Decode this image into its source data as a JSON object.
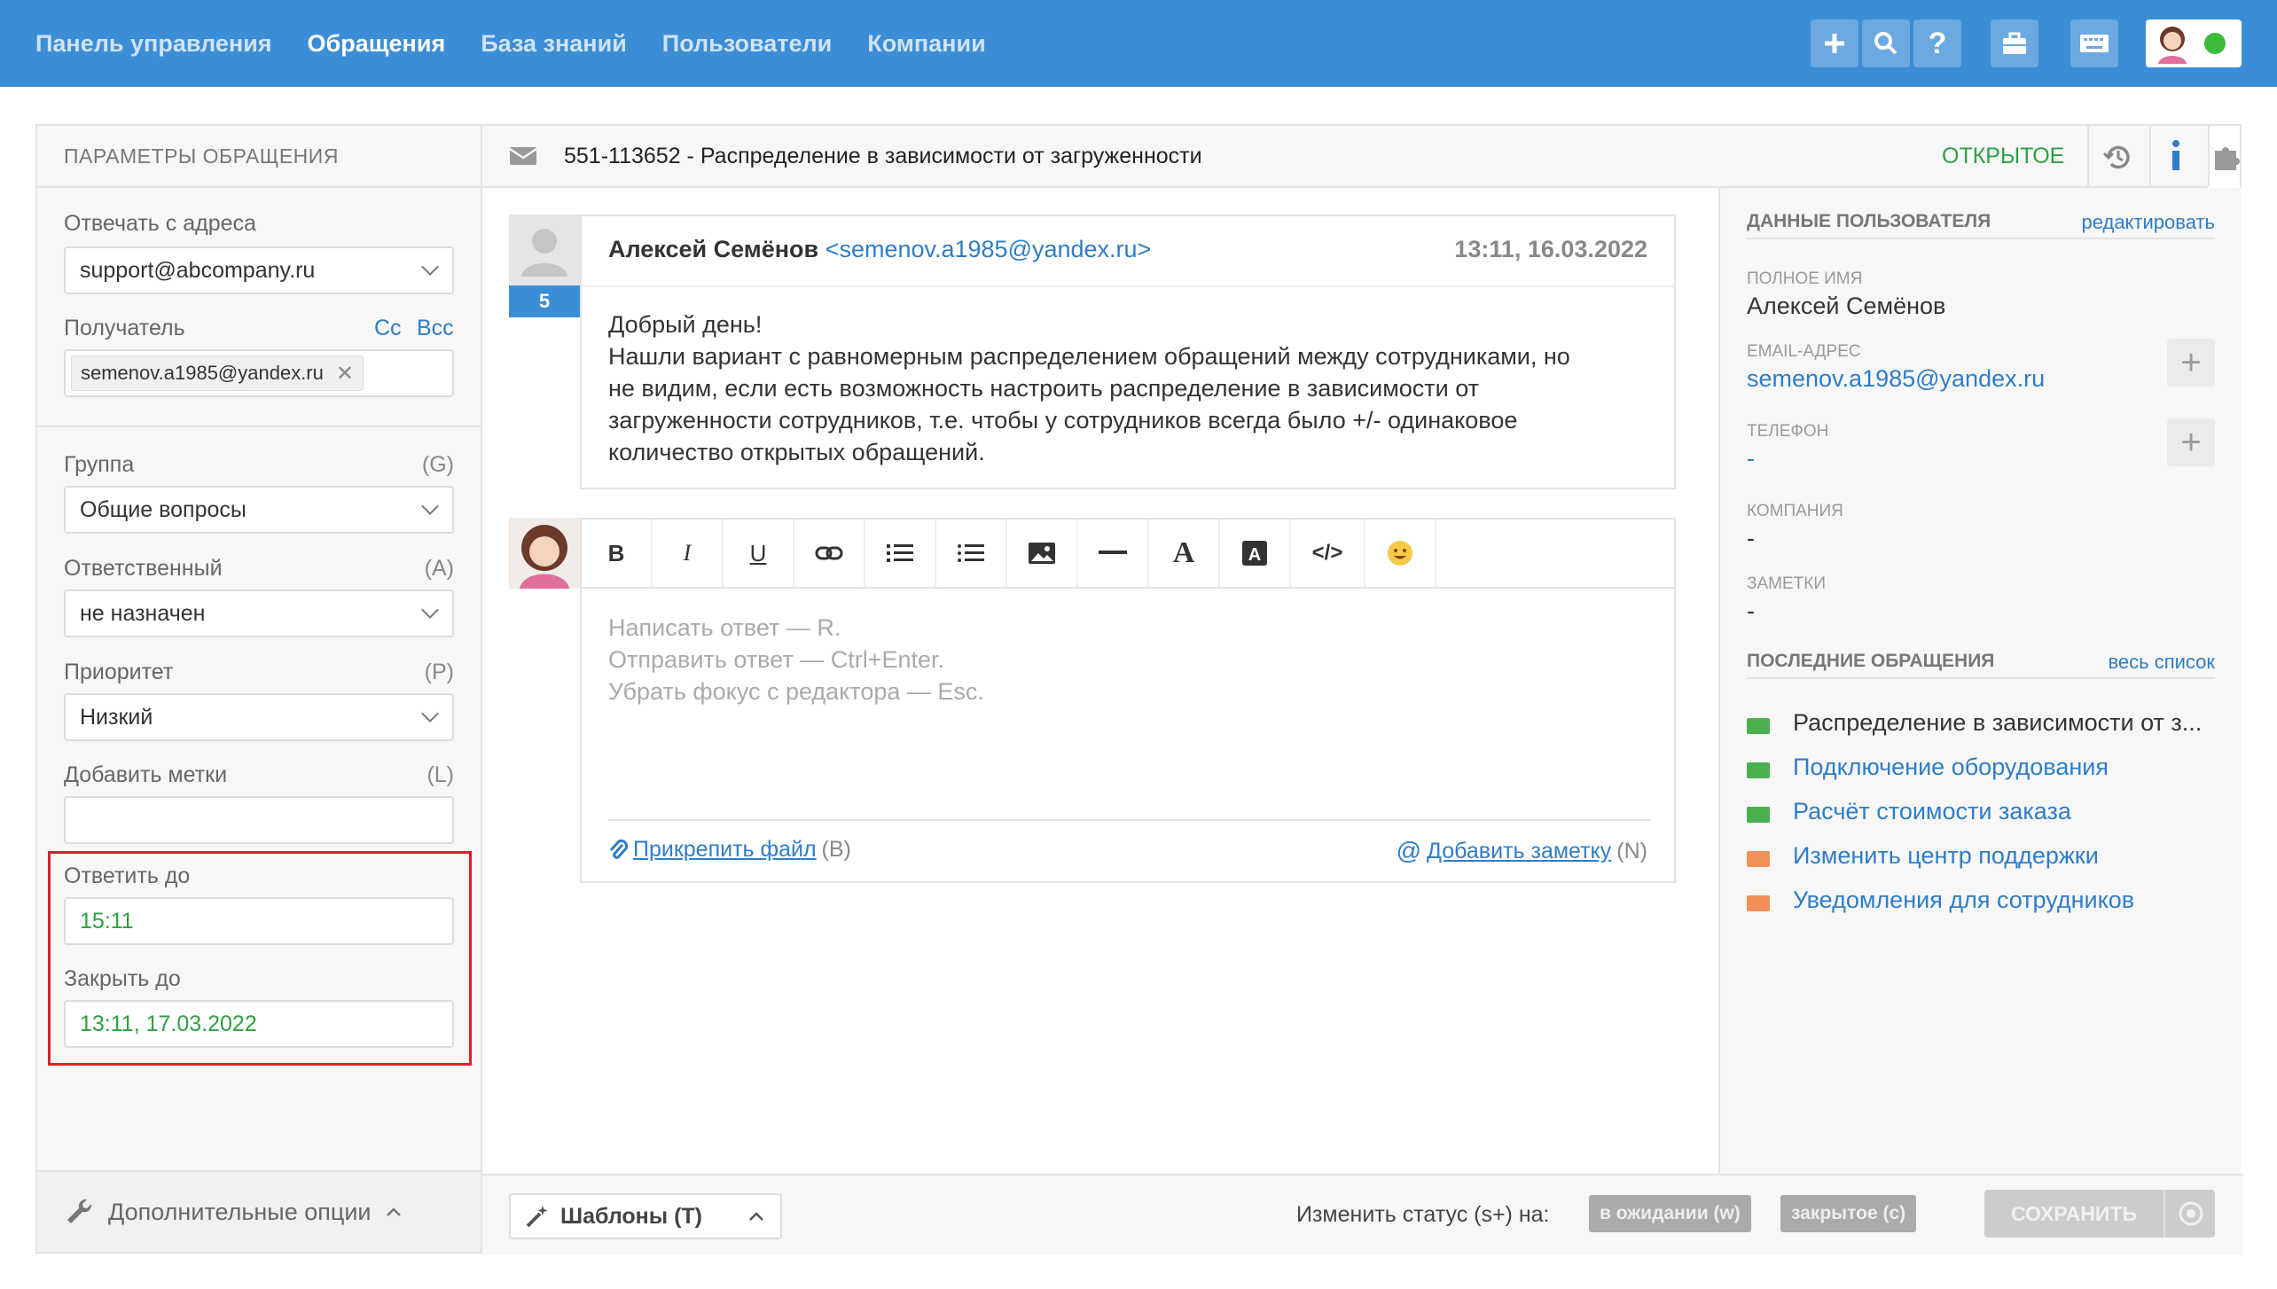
{
  "nav": {
    "items": [
      "Панель управления",
      "Обращения",
      "База знаний",
      "Пользователи",
      "Компании"
    ],
    "active": "Обращения"
  },
  "colors": {
    "topbar": "#3b8ed6",
    "accent": "#2f7dc7",
    "status_open": "#2ea043",
    "highlight_box": "#e01c2c"
  },
  "left": {
    "title": "ПАРАМЕТРЫ ОБРАЩЕНИЯ",
    "reply_from_label": "Отвечать с адреса",
    "reply_from_value": "support@abcompany.ru",
    "recipient_label": "Получатель",
    "cc": "Cc",
    "bcc": "Bcc",
    "recipient_chip": "semenov.a1985@yandex.ru",
    "group_label": "Группа",
    "group_key": "(G)",
    "group_value": "Общие вопросы",
    "assignee_label": "Ответственный",
    "assignee_key": "(A)",
    "assignee_value": "не назначен",
    "priority_label": "Приоритет",
    "priority_key": "(P)",
    "priority_value": "Низкий",
    "tags_label": "Добавить метки",
    "tags_key": "(L)",
    "reply_by_label": "Ответить до",
    "reply_by_value": "15:11",
    "close_by_label": "Закрыть до",
    "close_by_value": "13:11, 17.03.2022",
    "footer": "Дополнительные опции"
  },
  "ticket": {
    "title": "551-113652 - Распределение в зависимости от загруженности",
    "status": "ОТКРЫТОЕ"
  },
  "message": {
    "author": "Алексей Семёнов",
    "email": "<semenov.a1985@yandex.ru>",
    "time": "13:11, 16.03.2022",
    "count": "5",
    "lines": [
      "Добрый день!",
      "Нашли вариант с равномерным распределением обращений между сотрудниками, но",
      "не видим, если есть возможность настроить распределение в зависимости от",
      "загруженности сотрудников, т.е. чтобы у сотрудников всегда было +/- одинаковое",
      "количество открытых обращений."
    ]
  },
  "editor": {
    "placeholder_lines": [
      "Написать ответ — R.",
      "Отправить ответ — Ctrl+Enter.",
      "Убрать фокус с редактора — Esc."
    ],
    "attach": "Прикрепить файл",
    "attach_key": "(B)",
    "note": "Добавить заметку",
    "note_key": "(N)"
  },
  "footer": {
    "templates": "Шаблоны (T)",
    "change_status": "Изменить статус (s+) на:",
    "pending": "в ожидании (w)",
    "closed": "закрытое (c)",
    "save": "СОХРАНИТЬ"
  },
  "user": {
    "title": "ДАННЫЕ ПОЛЬЗОВАТЕЛЯ",
    "edit": "редактировать",
    "fullname_label": "ПОЛНОЕ ИМЯ",
    "fullname": "Алексей Семёнов",
    "email_label": "EMAIL-АДРЕС",
    "email": "semenov.a1985@yandex.ru",
    "phone_label": "ТЕЛЕФОН",
    "phone": "-",
    "company_label": "КОМПАНИЯ",
    "company": "-",
    "notes_label": "ЗАМЕТКИ",
    "notes": "-"
  },
  "recent": {
    "title": "ПОСЛЕДНИЕ ОБРАЩЕНИЯ",
    "all": "весь список",
    "items": [
      {
        "label": "Распределение в зависимости от з...",
        "color": "#4caf50"
      },
      {
        "label": "Подключение оборудования",
        "color": "#4caf50"
      },
      {
        "label": "Расчёт стоимости заказа",
        "color": "#4caf50"
      },
      {
        "label": "Изменить центр поддержки",
        "color": "#f0915a"
      },
      {
        "label": "Уведомления для сотрудников",
        "color": "#f0915a"
      }
    ]
  }
}
